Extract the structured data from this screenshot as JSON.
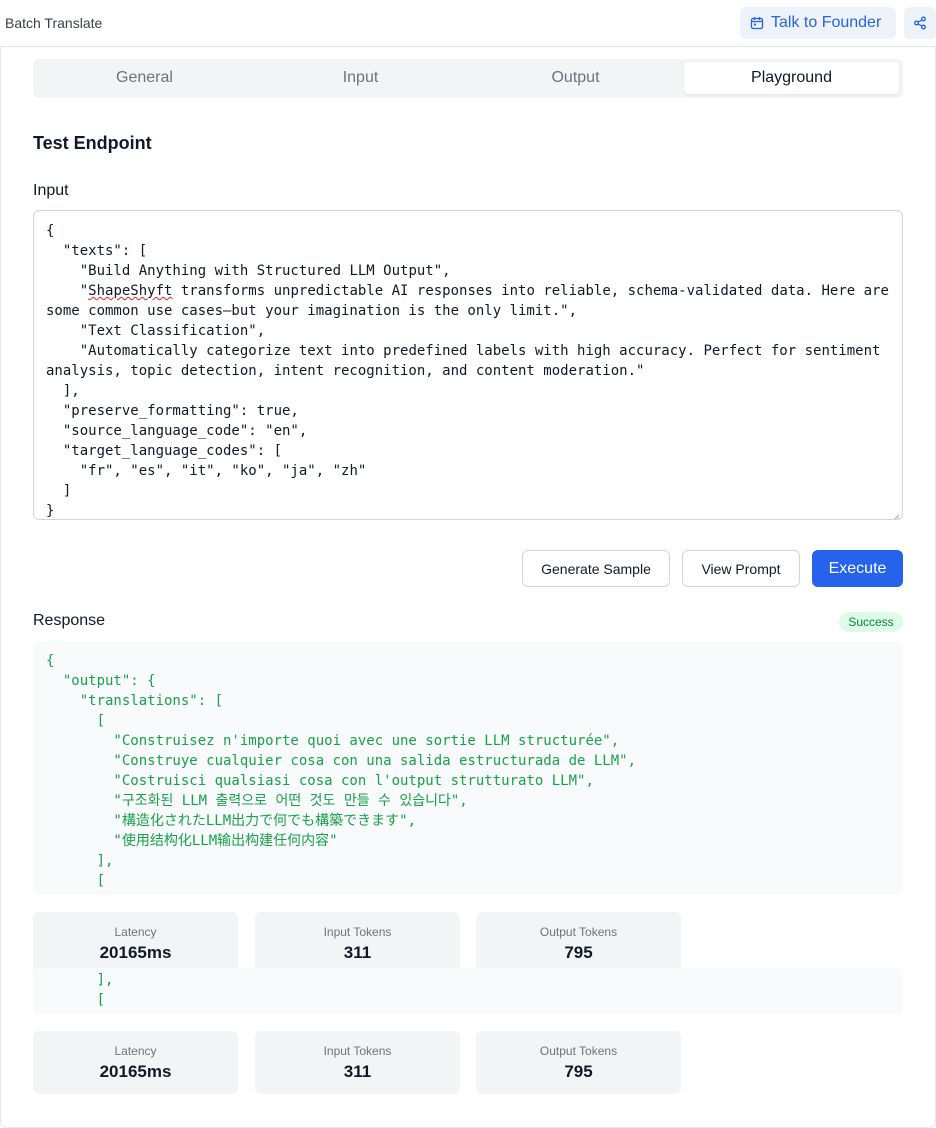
{
  "app": {
    "title": "Batch Translate"
  },
  "header": {
    "founder_button": "Talk to Founder"
  },
  "tabs": [
    "General",
    "Input",
    "Output",
    "Playground"
  ],
  "active_tab": "Playground",
  "section_title": "Test Endpoint",
  "input": {
    "label": "Input",
    "before_highlight": "{\n  \"texts\": [\n    \"Build Anything with Structured LLM Output\",\n    \"",
    "highlight": "ShapeShyft",
    "after_highlight": " transforms unpredictable AI responses into reliable, schema-validated data. Here are some common use cases—but your imagination is the only limit.\",\n    \"Text Classification\",\n    \"Automatically categorize text into predefined labels with high accuracy. Perfect for sentiment analysis, topic detection, intent recognition, and content moderation.\"\n  ],\n  \"preserve_formatting\": true,\n  \"source_language_code\": \"en\",\n  \"target_language_codes\": [\n    \"fr\", \"es\", \"it\", \"ko\", \"ja\", \"zh\"\n  ]\n}"
  },
  "actions": {
    "generate_sample": "Generate Sample",
    "view_prompt": "View Prompt",
    "execute": "Execute"
  },
  "response": {
    "label": "Response",
    "status": "Success",
    "body": "{\n  \"output\": {\n    \"translations\": [\n      [\n        \"Construisez n'importe quoi avec une sortie LLM structurée\",\n        \"Construye cualquier cosa con una salida estructurada de LLM\",\n        \"Costruisci qualsiasi cosa con l'output strutturato LLM\",\n        \"구조화된 LLM 출력으로 어떤 것도 만들 수 있습니다\",\n        \"構造化されたLLM出力で何でも構築できます\",\n        \"使用结构化LLM输出构建任何内容\"\n      ],\n      [",
    "body_tail": "      ],\n      ["
  },
  "stats": {
    "latency_label": "Latency",
    "latency": "20165ms",
    "input_tokens_label": "Input Tokens",
    "input_tokens": "311",
    "output_tokens_label": "Output Tokens",
    "output_tokens": "795"
  },
  "colors": {
    "accent": "#2563eb",
    "success_bg": "#dcfce7",
    "success_text": "#15803d",
    "json_text": "#16a34a"
  }
}
